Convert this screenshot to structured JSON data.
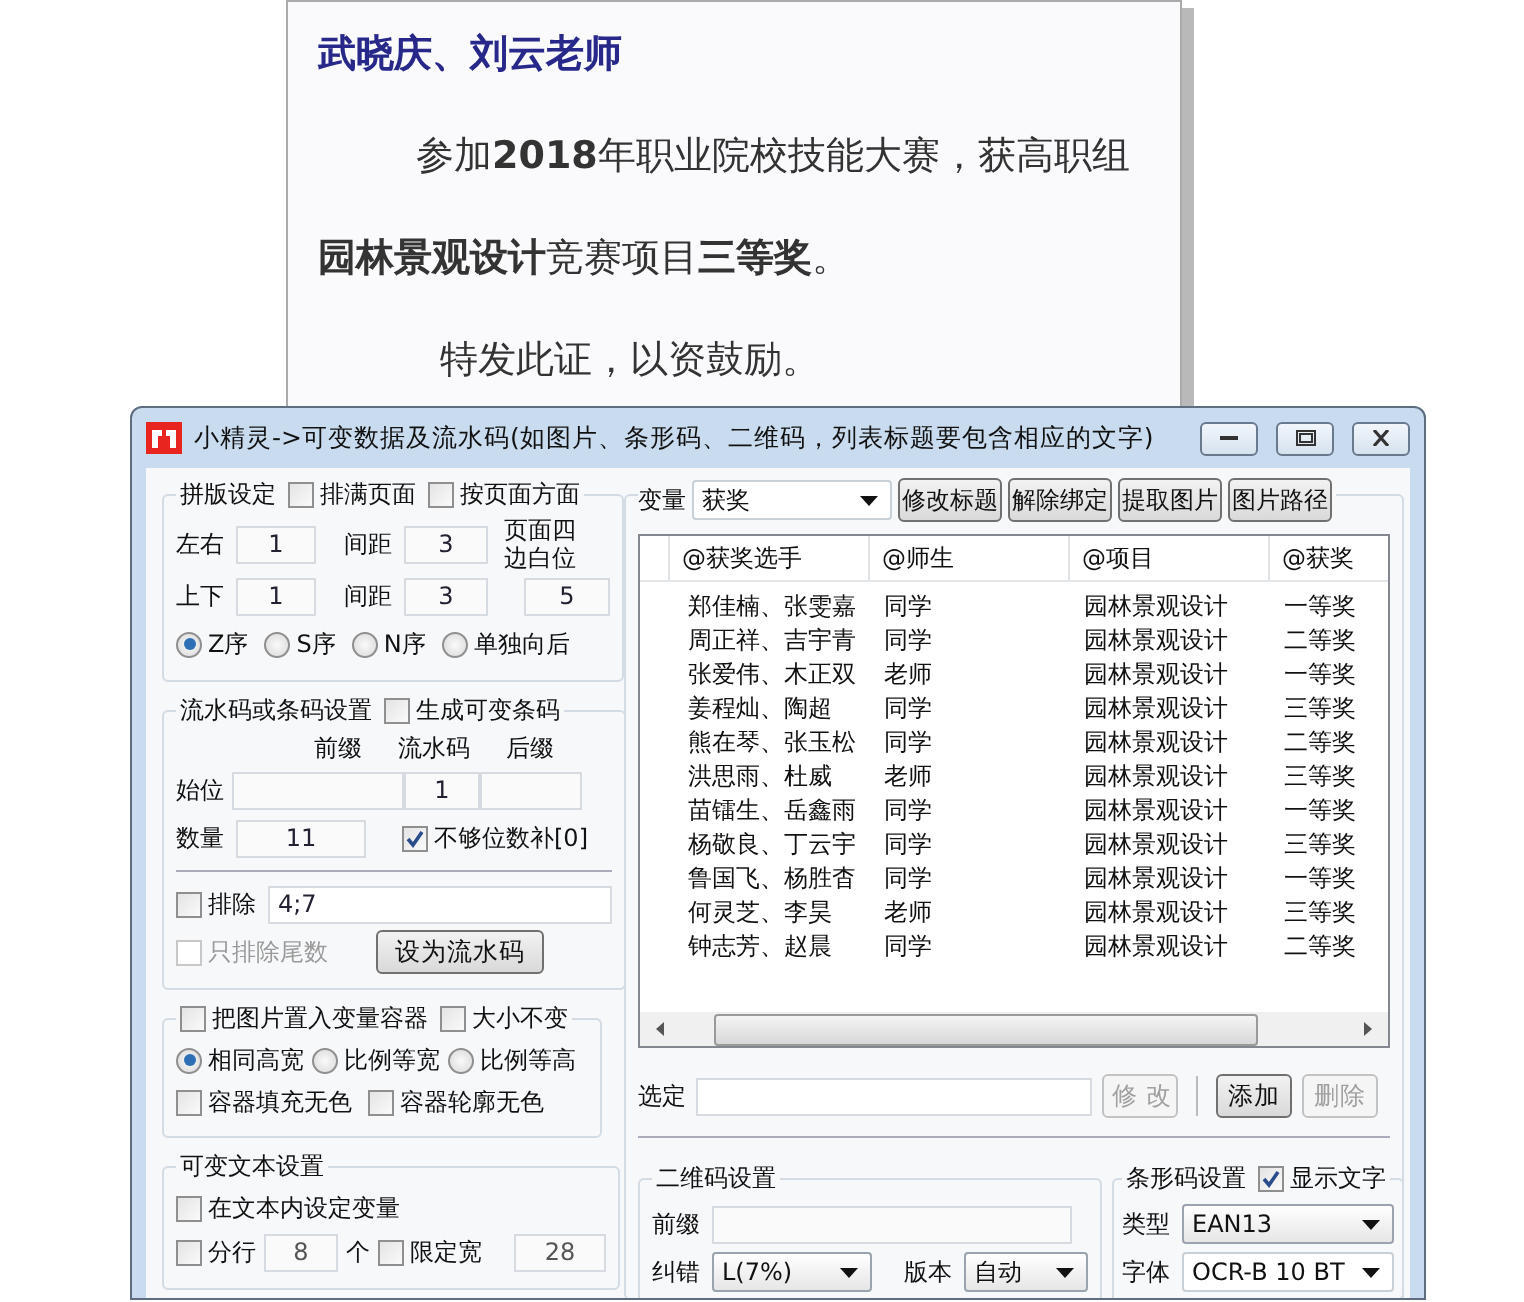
{
  "certificate": {
    "lines": [
      {
        "kind": "salutation",
        "text": "武晓庆、刘云老师"
      },
      {
        "kind": "paragraph",
        "text": "参加**2018**年职业院校技能大赛，获高职组"
      },
      {
        "kind": "continuation",
        "text": "**园林景观设计**竞赛项目**三等奖**。"
      },
      {
        "kind": "closing",
        "text": "特发此证，以资鼓励。"
      }
    ]
  },
  "window": {
    "title": "小精灵->可变数据及流水码(如图片、条形码、二维码，列表标题要包含相应的文字)"
  },
  "layout": {
    "legend": "拼版设定",
    "checks": [
      {
        "label": "排满页面",
        "checked": false
      },
      {
        "label": "按页面方面",
        "checked": false
      }
    ],
    "left_right": {
      "label": "左右",
      "value": "1"
    },
    "spacing_h": {
      "label": "间距",
      "value": "3"
    },
    "margin_label": "页面四边白位",
    "top_bottom": {
      "label": "上下",
      "value": "1"
    },
    "spacing_v": {
      "label": "间距",
      "value": "3"
    },
    "margin": {
      "value": "5"
    },
    "order": [
      {
        "label": "Z序",
        "selected": true
      },
      {
        "label": "S序",
        "selected": false
      },
      {
        "label": "N序",
        "selected": false
      },
      {
        "label": "单独向后",
        "selected": false
      }
    ]
  },
  "serial": {
    "legend": "流水码或条码设置",
    "generate": {
      "label": "生成可变条码",
      "checked": false
    },
    "headers": [
      "前缀",
      "流水码",
      "后缀"
    ],
    "start": {
      "label": "始位",
      "value": "1"
    },
    "count": {
      "label": "数量",
      "value": "11"
    },
    "pad_zero": {
      "label": "不够位数补[0]",
      "checked": true
    },
    "exclude": {
      "label": "排除",
      "checked": false,
      "value": "4;7"
    },
    "tail_only": {
      "label": "只排除尾数",
      "checked": false,
      "disabled": true
    },
    "set_button": "设为流水码"
  },
  "picture": {
    "checks": [
      {
        "label": "把图片置入变量容器",
        "checked": false
      },
      {
        "label": "大小不变",
        "checked": false
      }
    ],
    "modes": [
      {
        "label": "相同高宽",
        "selected": true
      },
      {
        "label": "比例等宽",
        "selected": false
      },
      {
        "label": "比例等高",
        "selected": false
      }
    ],
    "options": [
      {
        "label": "容器填充无色",
        "checked": false
      },
      {
        "label": "容器轮廓无色",
        "checked": false
      }
    ]
  },
  "text_settings": {
    "legend": "可变文本设置",
    "inline": {
      "label": "在文本内设定变量",
      "checked": false
    },
    "split": {
      "label": "分行",
      "checked": false,
      "value": "8",
      "unit": "个"
    },
    "limit": {
      "label": "限定宽",
      "checked": false,
      "value": "28"
    }
  },
  "variable": {
    "label": "变量",
    "value": "获奖",
    "buttons": [
      "修改标题",
      "解除绑定",
      "提取图片",
      "图片路径"
    ]
  },
  "table": {
    "columns": [
      "@获奖选手",
      "@师生",
      "@项目",
      "@获奖"
    ],
    "rows": [
      {
        "cells": [
          "郑佳楠、张雯嘉",
          "同学",
          "园林景观设计",
          "一等奖"
        ]
      },
      {
        "cells": [
          "周正祥、吉宇青",
          "同学",
          "园林景观设计",
          "二等奖"
        ]
      },
      {
        "cells": [
          "张爱伟、木正双",
          "老师",
          "园林景观设计",
          "一等奖"
        ]
      },
      {
        "cells": [
          "姜程灿、陶超",
          "同学",
          "园林景观设计",
          "三等奖"
        ]
      },
      {
        "cells": [
          "熊在琴、张玉松",
          "同学",
          "园林景观设计",
          "二等奖"
        ]
      },
      {
        "cells": [
          "洪思雨、杜威",
          "老师",
          "园林景观设计",
          "三等奖"
        ]
      },
      {
        "cells": [
          "苗镭生、岳鑫雨",
          "同学",
          "园林景观设计",
          "一等奖"
        ]
      },
      {
        "cells": [
          "杨敬良、丁云宇",
          "同学",
          "园林景观设计",
          "三等奖"
        ]
      },
      {
        "cells": [
          "鲁国飞、杨胜杳",
          "同学",
          "园林景观设计",
          "一等奖"
        ]
      },
      {
        "cells": [
          "何灵芝、李昊",
          "老师",
          "园林景观设计",
          "三等奖"
        ]
      },
      {
        "cells": [
          "钟志芳、赵晨",
          "同学",
          "园林景观设计",
          "二等奖"
        ]
      }
    ]
  },
  "selection": {
    "label": "选定",
    "buttons": [
      {
        "label": "修 改",
        "disabled": true
      },
      {
        "label": "添加",
        "disabled": false
      },
      {
        "label": "删除",
        "disabled": true
      }
    ]
  },
  "qr": {
    "legend": "二维码设置",
    "prefix_label": "前缀",
    "correction": {
      "label": "纠错",
      "value": "L(7%)"
    },
    "version": {
      "label": "版本",
      "value": "自动"
    }
  },
  "barcode": {
    "legend": "条形码设置",
    "show_text": {
      "label": "显示文字",
      "checked": true
    },
    "type": {
      "label": "类型",
      "value": "EAN13"
    },
    "font": {
      "label": "字体",
      "value": "OCR-B 10 BT"
    }
  }
}
